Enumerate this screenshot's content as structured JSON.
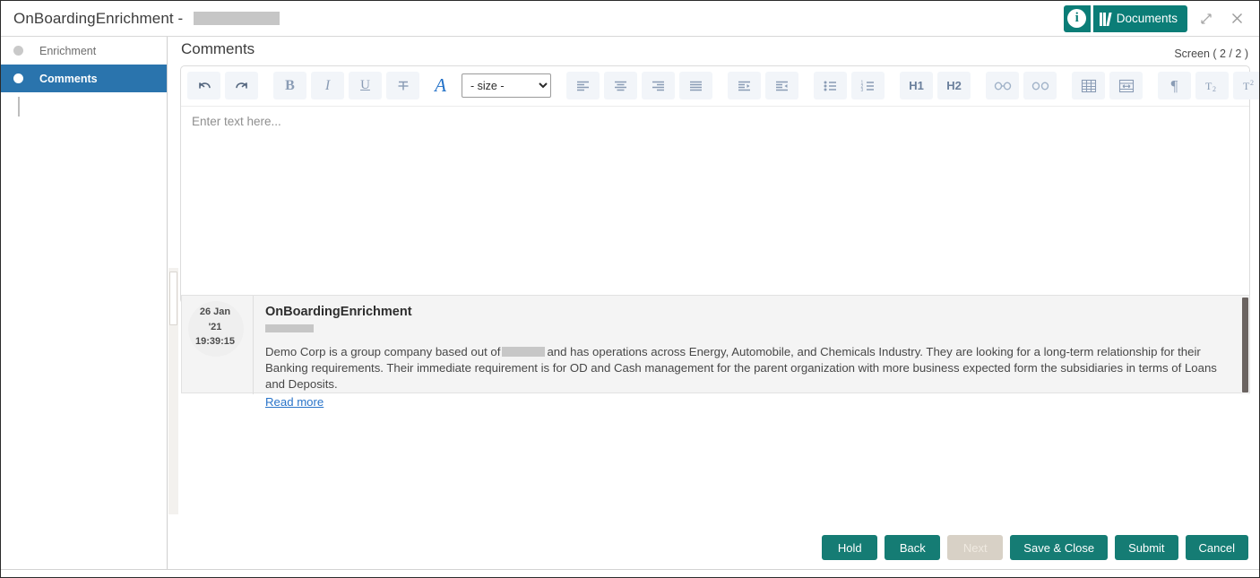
{
  "window": {
    "title": "OnBoardingEnrichment - ",
    "title_redacted": true,
    "info_icon": "info-icon",
    "documents_label": "Documents",
    "minimize_icon": "minimize-icon",
    "close_icon": "close-icon",
    "accent_color": "#0b7d77"
  },
  "sidebar": {
    "items": [
      {
        "label": "Enrichment",
        "active": false
      },
      {
        "label": "Comments",
        "active": true
      }
    ],
    "active_color": "#2a74ad"
  },
  "main": {
    "page_title": "Comments",
    "screen_counter": "Screen ( 2 / 2 )"
  },
  "editor": {
    "placeholder": "Enter text here...",
    "size_select_value": "- size -",
    "toolbar": [
      {
        "name": "undo-icon",
        "label": ""
      },
      {
        "name": "redo-icon",
        "label": ""
      },
      {
        "name": "bold-icon",
        "label": "B"
      },
      {
        "name": "italic-icon",
        "label": "I"
      },
      {
        "name": "underline-icon",
        "label": "U"
      },
      {
        "name": "strikethrough-icon",
        "label": "T"
      },
      {
        "name": "font-color-icon",
        "label": "A"
      },
      {
        "name": "align-left-icon",
        "label": ""
      },
      {
        "name": "align-center-icon",
        "label": ""
      },
      {
        "name": "align-right-icon",
        "label": ""
      },
      {
        "name": "align-justify-icon",
        "label": ""
      },
      {
        "name": "indent-increase-icon",
        "label": ""
      },
      {
        "name": "indent-decrease-icon",
        "label": ""
      },
      {
        "name": "bullet-list-icon",
        "label": ""
      },
      {
        "name": "numbered-list-icon",
        "label": ""
      },
      {
        "name": "heading-1-icon",
        "label": "H1"
      },
      {
        "name": "heading-2-icon",
        "label": "H2"
      },
      {
        "name": "insert-link-icon",
        "label": ""
      },
      {
        "name": "remove-link-icon",
        "label": ""
      },
      {
        "name": "insert-table-icon",
        "label": ""
      },
      {
        "name": "table-cell-width-icon",
        "label": ""
      },
      {
        "name": "paragraph-icon",
        "label": "¶"
      },
      {
        "name": "subscript-icon",
        "label": "T"
      },
      {
        "name": "superscript-icon",
        "label": "T"
      }
    ]
  },
  "comments": [
    {
      "date_day": "26 Jan",
      "date_year": "'21",
      "date_time": "19:39:15",
      "author": "OnBoardingEnrichment",
      "author_sub_redacted": true,
      "text_part_1": "Demo Corp is a group company based out of",
      "text_redacted": true,
      "text_part_2": "and has operations across Energy, Automobile, and Chemicals Industry. They are looking for a long-term relationship for their Banking requirements. Their immediate requirement is for OD and Cash management for the parent organization with more business expected form the subsidiaries in terms of Loans and Deposits.",
      "read_more_label": "Read more"
    }
  ],
  "footer": {
    "buttons": [
      {
        "label": "Hold",
        "disabled": false
      },
      {
        "label": "Back",
        "disabled": false
      },
      {
        "label": "Next",
        "disabled": true
      },
      {
        "label": "Save & Close",
        "disabled": false
      },
      {
        "label": "Submit",
        "disabled": false
      },
      {
        "label": "Cancel",
        "disabled": false
      }
    ],
    "primary_color": "#157c74",
    "disabled_color": "#d8d1c6"
  }
}
